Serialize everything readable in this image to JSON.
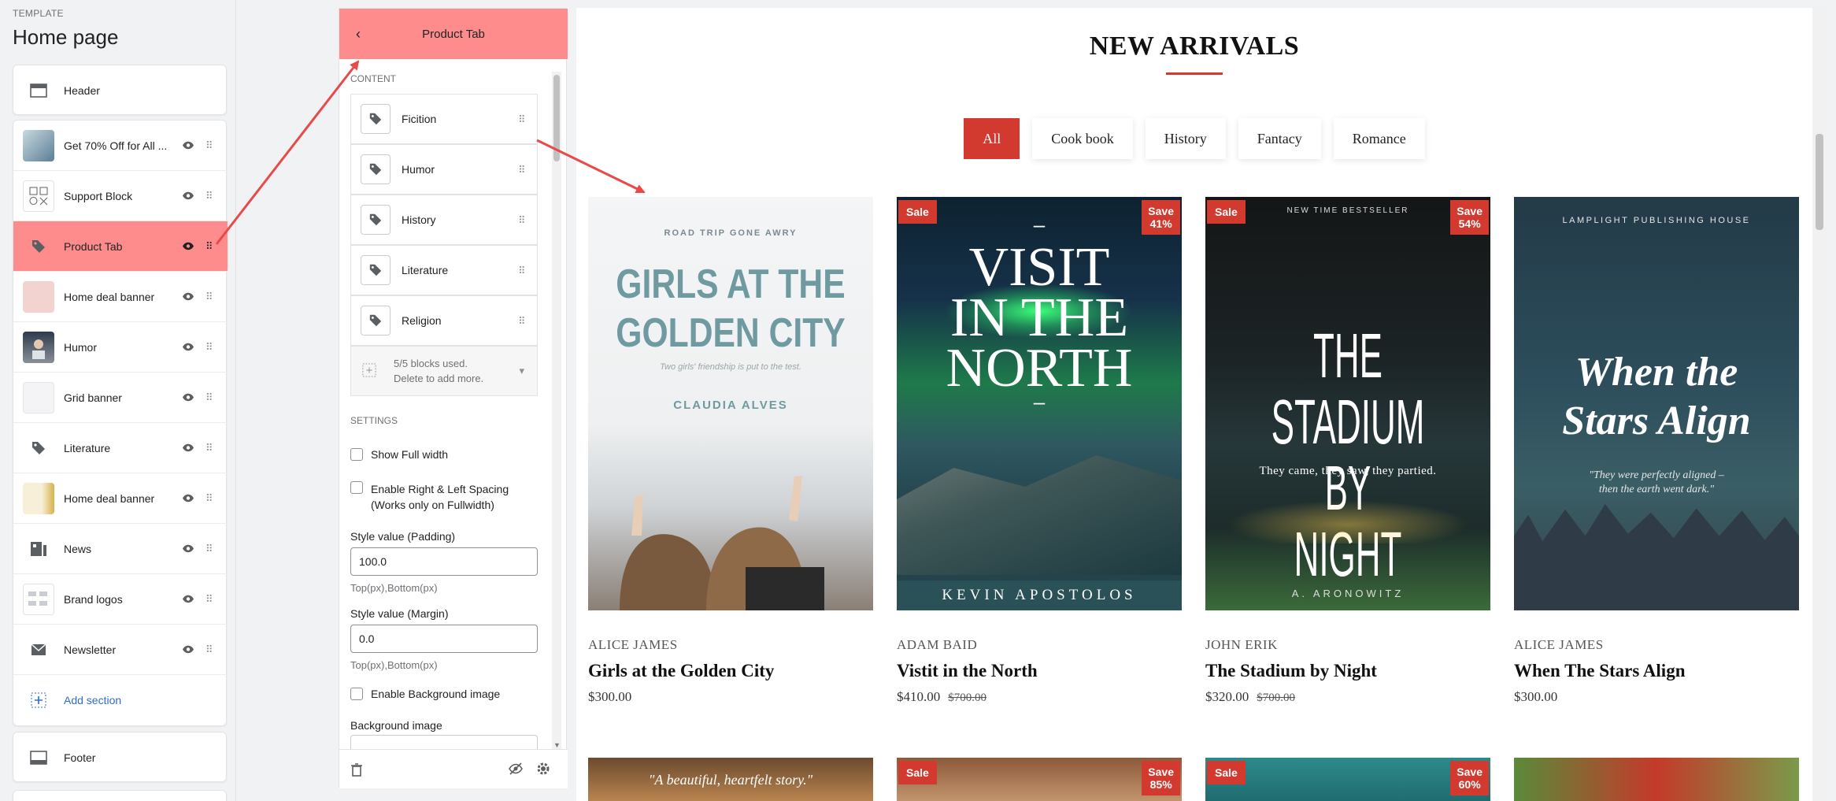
{
  "sidebar": {
    "template_label": "TEMPLATE",
    "title": "Home page",
    "header_label": "Header",
    "sections": [
      {
        "label": "Get 70% Off for All ...",
        "icon": "image-thumb-icon"
      },
      {
        "label": "Support Block",
        "icon": "support-icon"
      },
      {
        "label": "Product Tab",
        "icon": "tag-icon"
      },
      {
        "label": "Home deal banner",
        "icon": "banner-thumb-icon"
      },
      {
        "label": "Humor",
        "icon": "portrait-thumb-icon"
      },
      {
        "label": "Grid banner",
        "icon": "grid-thumb-icon"
      },
      {
        "label": "Literature",
        "icon": "tag-icon"
      },
      {
        "label": "Home deal banner",
        "icon": "banner-thumb-icon"
      },
      {
        "label": "News",
        "icon": "news-icon"
      },
      {
        "label": "Brand logos",
        "icon": "logos-icon"
      },
      {
        "label": "Newsletter",
        "icon": "mail-icon"
      }
    ],
    "add_section_label": "Add section",
    "footer_label": "Footer"
  },
  "panel": {
    "title": "Product Tab",
    "content_label": "CONTENT",
    "blocks": [
      {
        "label": "Ficition"
      },
      {
        "label": "Humor"
      },
      {
        "label": "History"
      },
      {
        "label": "Literature"
      },
      {
        "label": "Religion"
      }
    ],
    "blocks_used_line1": "5/5 blocks used.",
    "blocks_used_line2": "Delete to add more.",
    "settings_label": "SETTINGS",
    "show_full_width": "Show Full width",
    "spacing_line1": "Enable Right & Left Spacing",
    "spacing_line2": "(Works only on Fullwidth)",
    "padding_label": "Style value (Padding)",
    "padding_value": "100.0",
    "padding_hint": "Top(px),Bottom(px)",
    "margin_label": "Style value (Margin)",
    "margin_value": "0.0",
    "margin_hint": "Top(px),Bottom(px)",
    "bg_image_toggle": "Enable Background image",
    "bg_image_label": "Background image"
  },
  "preview": {
    "heading": "NEW ARRIVALS",
    "tabs": [
      "All",
      "Cook book",
      "History",
      "Fantacy",
      "Romance"
    ],
    "products": [
      {
        "author": "ALICE JAMES",
        "title": "Girls at the Golden City",
        "price": "$300.00",
        "old_price": "",
        "sale": "",
        "save1": "",
        "save2": "",
        "cover_top": "ROAD TRIP GONE AWRY",
        "cover_title1": "GIRLS AT THE",
        "cover_title2": "GOLDEN CITY",
        "cover_sub": "Two girls' friendship is put to the test.",
        "cover_author": "CLAUDIA ALVES"
      },
      {
        "author": "ADAM BAID",
        "title": "Vistit in the North",
        "price": "$410.00",
        "old_price": "$700.00",
        "sale": "Sale",
        "save1": "Save",
        "save2": "41%",
        "cover_title1": "VISIT",
        "cover_title2": "IN THE",
        "cover_title3": "NORTH",
        "cover_author": "KEVIN APOSTOLOS"
      },
      {
        "author": "JOHN ERIK",
        "title": "The Stadium by Night",
        "price": "$320.00",
        "old_price": "$700.00",
        "sale": "Sale",
        "save1": "Save",
        "save2": "54%",
        "cover_top": "NEW TIME BESTSELLER",
        "cover_title1": "THE STADIUM",
        "cover_title2": "BY NIGHT",
        "cover_sub": "They came, they saw, they partied.",
        "cover_author": "A. ARONOWITZ"
      },
      {
        "author": "ALICE JAMES",
        "title": "When The Stars Align",
        "price": "$300.00",
        "old_price": "",
        "sale": "",
        "save1": "",
        "save2": "",
        "cover_top": "LAMPLIGHT PUBLISHING HOUSE",
        "cover_title1": "When the",
        "cover_title2": "Stars Align",
        "cover_sub1": "\"They were perfectly aligned –",
        "cover_sub2": "then the earth went dark.\""
      }
    ],
    "row2": [
      {
        "sale": "",
        "save1": "",
        "save2": "",
        "cover_text": "\"A beautiful, heartfelt story.\""
      },
      {
        "sale": "Sale",
        "save1": "Save",
        "save2": "85%"
      },
      {
        "sale": "Sale",
        "save1": "Save",
        "save2": "60%"
      },
      {
        "sale": "",
        "save1": "",
        "save2": ""
      }
    ]
  },
  "colors": {
    "accent": "#d23a30",
    "highlight": "#ff8c8c",
    "link": "#2c6ecb"
  }
}
